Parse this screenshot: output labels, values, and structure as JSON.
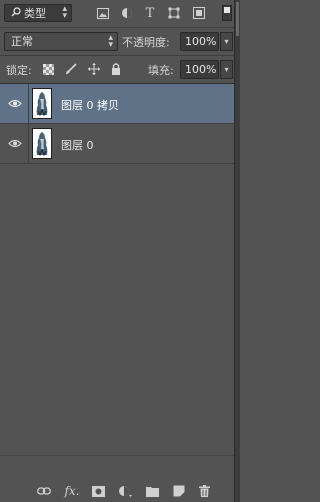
{
  "filter": {
    "selected": "类型",
    "icons": [
      "image-filter-icon",
      "adjustment-filter-icon",
      "type-filter-icon",
      "shape-filter-icon",
      "smart-object-filter-icon"
    ],
    "type_glyph": "T"
  },
  "blend": {
    "mode": "正常",
    "opacity_label": "不透明度:",
    "opacity_value": "100%"
  },
  "lock": {
    "label": "锁定:",
    "icons": [
      "lock-transparent-pixels-icon",
      "lock-image-pixels-icon",
      "lock-position-icon",
      "lock-all-icon"
    ],
    "fill_label": "填充:",
    "fill_value": "100%"
  },
  "layers": [
    {
      "name": "图层 0 拷贝",
      "visible": true,
      "selected": true
    },
    {
      "name": "图层 0",
      "visible": true,
      "selected": false
    }
  ],
  "bottom_bar": {
    "fx_label": "fx.",
    "icons": [
      "link-layers-icon",
      "layer-style-icon",
      "add-mask-icon",
      "adjustment-layer-icon",
      "new-group-icon",
      "new-layer-icon",
      "delete-layer-icon"
    ]
  },
  "colors": {
    "panel_bg": "#535353",
    "selected_row": "#5f7288"
  }
}
